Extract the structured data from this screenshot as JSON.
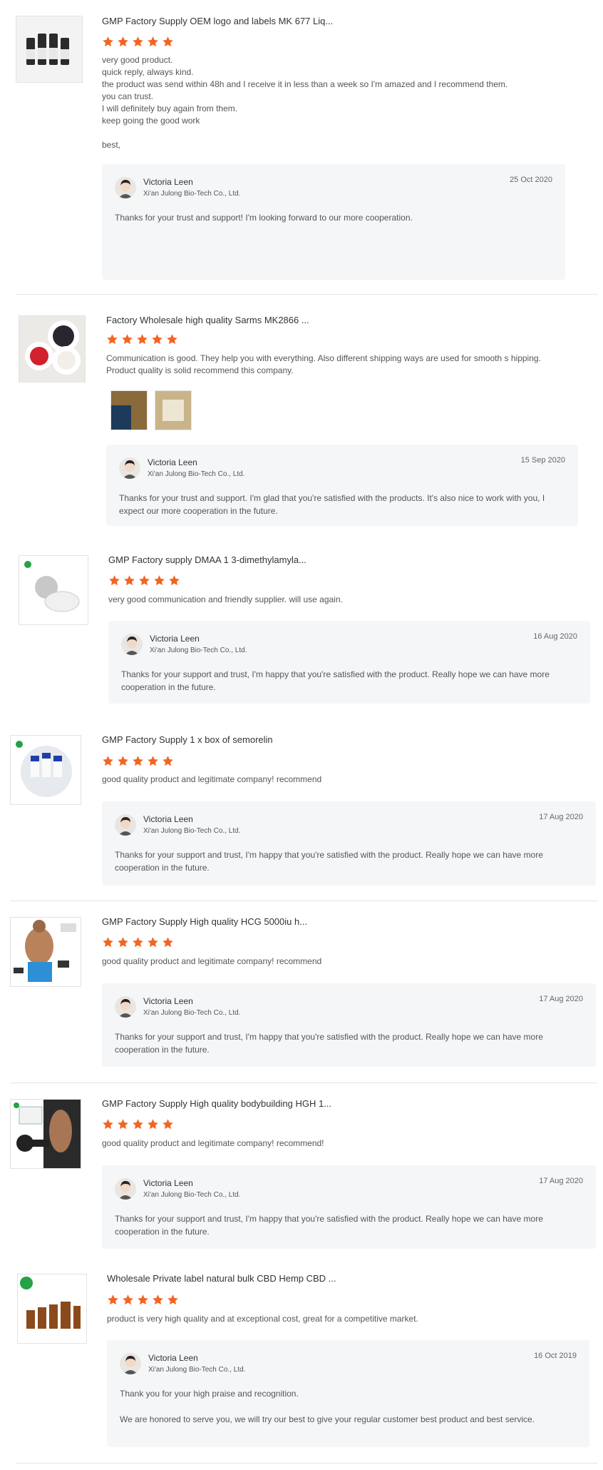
{
  "reviews": [
    {
      "title": "GMP Factory Supply OEM logo and labels MK 677 Liq...",
      "rating": 5,
      "body": [
        "very good product.",
        "quick reply, always kind.",
        "the product was send within 48h and I receive it in less than a week so I'm amazed and I recommend them.",
        "you can trust.",
        "I will definitely buy again from them.",
        "keep going the good work",
        "",
        "best,"
      ],
      "reply": {
        "name": "Victoria Leen",
        "company": "Xi'an Julong Bio-Tech Co., Ltd.",
        "date": "25 Oct 2020",
        "text": [
          "Thanks for your trust and support! I'm looking forward to our more cooperation."
        ]
      }
    },
    {
      "title": "Factory Wholesale high quality Sarms MK2866 ...",
      "rating": 5,
      "body": [
        "Communication is good. They help you with everything. Also different shipping ways are used for smooth s hipping. Product quality is solid recommend this company."
      ],
      "reply": {
        "name": "Victoria Leen",
        "company": "Xi'an Julong Bio-Tech Co., Ltd.",
        "date": "15 Sep 2020",
        "text": [
          "Thanks for your trust and support. I'm glad that you're satisfied with the products. It's also nice to work with you, I expect our more cooperation in the future."
        ]
      }
    },
    {
      "title": "GMP Factory supply DMAA 1 3-dimethylamyla...",
      "rating": 5,
      "body": [
        "very good communication and friendly supplier. will use again."
      ],
      "reply": {
        "name": "Victoria Leen",
        "company": "Xi'an Julong Bio-Tech Co., Ltd.",
        "date": "16 Aug 2020",
        "text": [
          "Thanks for your support and trust, I'm happy that you're satisfied with the product. Really hope we can have more cooperation in the future."
        ]
      }
    },
    {
      "title": "GMP Factory Supply 1 x box of semorelin",
      "rating": 5,
      "body": [
        "good quality product and legitimate company! recommend"
      ],
      "reply": {
        "name": "Victoria Leen",
        "company": "Xi'an Julong Bio-Tech Co., Ltd.",
        "date": "17 Aug 2020",
        "text": [
          "Thanks for your support and trust, I'm happy that you're satisfied with the product. Really hope we can have more cooperation in the future."
        ]
      }
    },
    {
      "title": "GMP Factory Supply High quality HCG 5000iu h...",
      "rating": 5,
      "body": [
        "good quality product and legitimate company! recommend"
      ],
      "reply": {
        "name": "Victoria Leen",
        "company": "Xi'an Julong Bio-Tech Co., Ltd.",
        "date": "17 Aug 2020",
        "text": [
          "Thanks for your support and trust, I'm happy that you're satisfied with the product. Really hope we can have more cooperation in the future."
        ]
      }
    },
    {
      "title": "GMP Factory Supply High quality bodybuilding HGH 1...",
      "rating": 5,
      "body": [
        "good quality product and legitimate company! recommend!"
      ],
      "reply": {
        "name": "Victoria Leen",
        "company": "Xi'an Julong Bio-Tech Co., Ltd.",
        "date": "17 Aug 2020",
        "text": [
          "Thanks for your support and trust, I'm happy that you're satisfied with the product. Really hope we can have more cooperation in the future."
        ]
      }
    },
    {
      "title": "Wholesale Private label natural bulk CBD Hemp CBD ...",
      "rating": 5,
      "body": [
        "product is very high quality and at exceptional cost, great for a competitive market."
      ],
      "reply": {
        "name": "Victoria Leen",
        "company": "Xi'an Julong Bio-Tech Co., Ltd.",
        "date": "16 Oct 2019",
        "text": [
          "Thank you for your high praise and recognition.",
          "We are honored to serve you, we will try our best to give your regular customer best product and best service."
        ]
      }
    }
  ],
  "colors": {
    "star": "#f26522",
    "reply_bg": "#f5f6f8",
    "divider": "#e4e4e4"
  },
  "icons": {
    "rating": "star-icon",
    "avatar": "reviewer-avatar"
  }
}
